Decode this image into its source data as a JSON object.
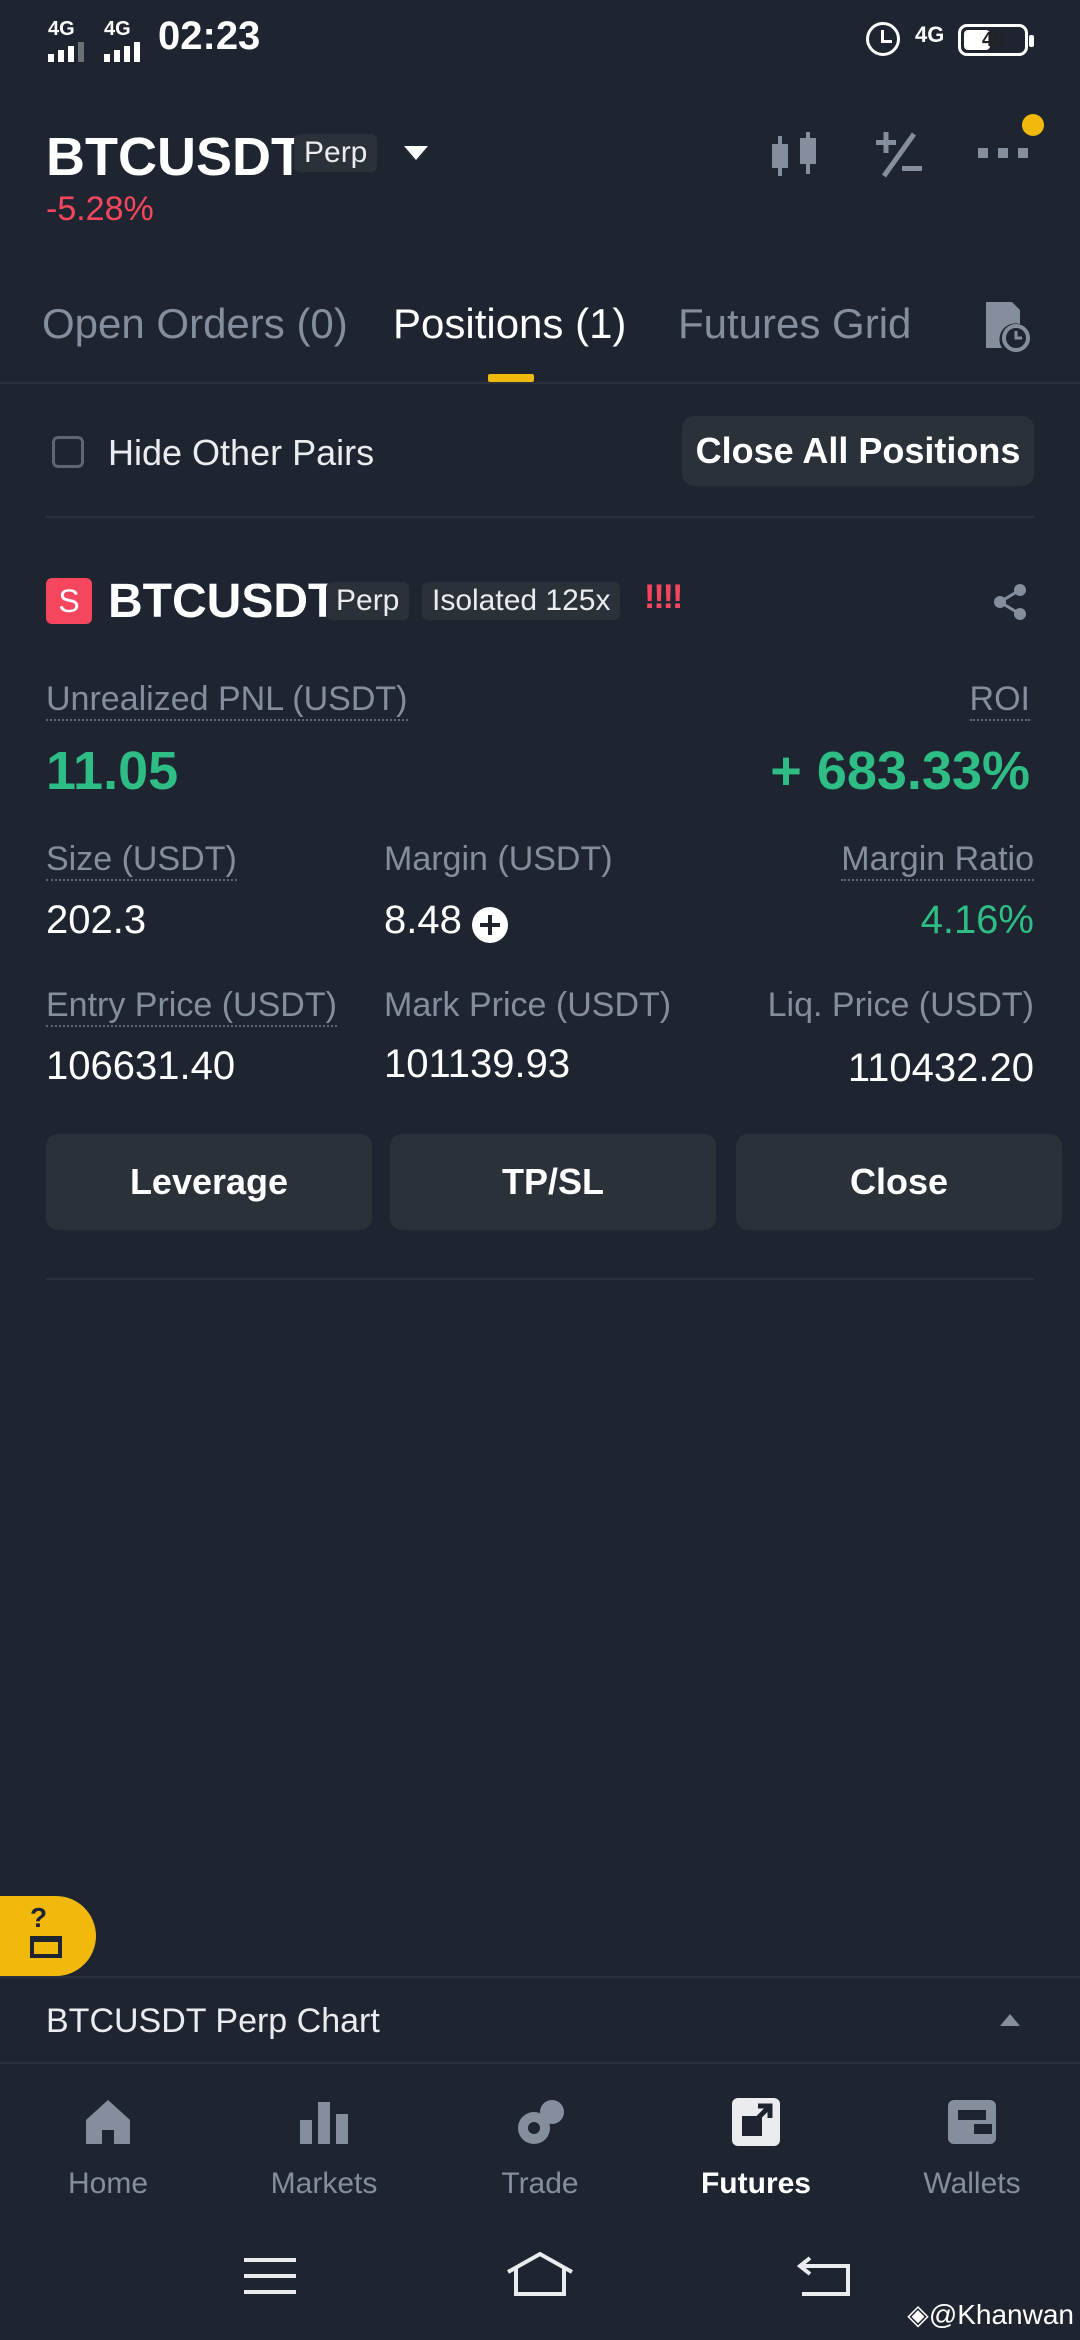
{
  "status_bar": {
    "net1": "4G",
    "net2": "4G",
    "time": "02:23",
    "net3": "4G",
    "battery": "40"
  },
  "header": {
    "pair": "BTCUSDT",
    "type_badge": "Perp",
    "change": "-5.28%",
    "icons": [
      "candlestick-chart-icon",
      "plus-minus-icon",
      "more-icon"
    ]
  },
  "tabs": [
    {
      "label": "Open Orders (0)",
      "active": false
    },
    {
      "label": "Positions (1)",
      "active": true
    },
    {
      "label": "Futures Grid",
      "active": false
    }
  ],
  "filter": {
    "hide_other_pairs": "Hide Other Pairs",
    "close_all": "Close All Positions"
  },
  "position": {
    "side": "S",
    "symbol": "BTCUSDT",
    "type": "Perp",
    "margin_mode": "Isolated 125x",
    "warning": "!!!!",
    "unrealized_pnl_label": "Unrealized PNL (USDT)",
    "unrealized_pnl": "11.05",
    "roi_label": "ROI",
    "roi": "+ 683.33%",
    "size_label": "Size (USDT)",
    "size": "202.3",
    "margin_label": "Margin (USDT)",
    "margin": "8.48",
    "margin_ratio_label": "Margin Ratio",
    "margin_ratio": "4.16%",
    "entry_label": "Entry Price (USDT)",
    "entry": "106631.40",
    "mark_label": "Mark Price (USDT)",
    "mark": "101139.93",
    "liq_label": "Liq. Price (USDT)",
    "liq": "110432.20",
    "buttons": {
      "leverage": "Leverage",
      "tpsl": "TP/SL",
      "close": "Close"
    }
  },
  "chart_bar": {
    "label": "BTCUSDT Perp Chart"
  },
  "bottom_nav": [
    {
      "label": "Home",
      "active": false
    },
    {
      "label": "Markets",
      "active": false
    },
    {
      "label": "Trade",
      "active": false
    },
    {
      "label": "Futures",
      "active": true
    },
    {
      "label": "Wallets",
      "active": false
    }
  ],
  "watermark": "@Khanwan",
  "colors": {
    "accent": "#f0b90b",
    "positive": "#2ebd85",
    "negative": "#f6465d",
    "background": "#1f2530"
  }
}
